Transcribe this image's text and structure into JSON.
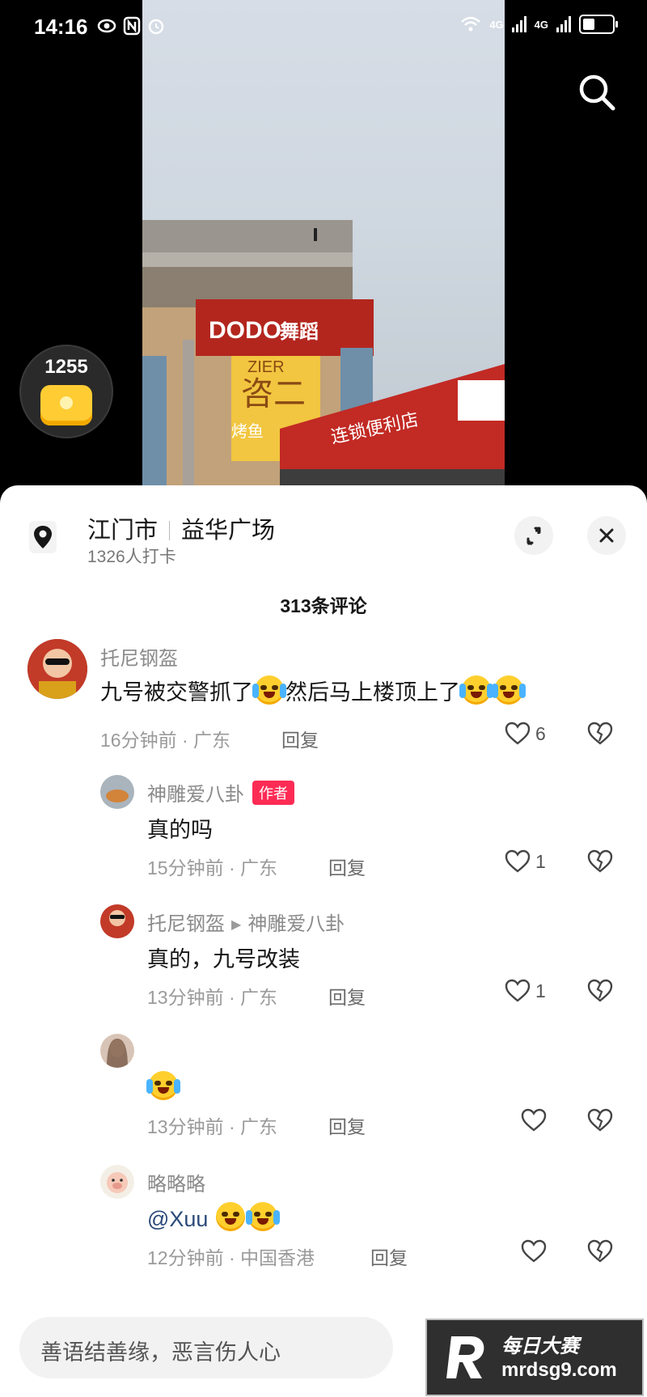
{
  "status_bar": {
    "time": "14:16",
    "signal_1": "4G",
    "signal_2": "4G"
  },
  "coin_badge": {
    "count": "1255"
  },
  "location": {
    "city": "江门市",
    "place": "益华广场",
    "checkins": "1326人打卡"
  },
  "comments_count": "313条评论",
  "author_tag": "作者",
  "reply_label": "回复",
  "comments": [
    {
      "user": "托尼钢盔",
      "text_parts": [
        "九号被交警抓了",
        "然后马上楼顶上了"
      ],
      "time": "16分钟前",
      "region": "广东",
      "likes": "6"
    },
    {
      "user": "神雕爱八卦",
      "text": "真的吗",
      "time": "15分钟前",
      "region": "广东",
      "likes": "1"
    },
    {
      "user": "托尼钢盔",
      "reply_to": "神雕爱八卦",
      "text": "真的，九号改装",
      "time": "13分钟前",
      "region": "广东",
      "likes": "1"
    },
    {
      "user": "",
      "text": "",
      "time": "13分钟前",
      "region": "广东",
      "likes": ""
    },
    {
      "user": "略略略",
      "text": "@Xuu",
      "time": "12分钟前",
      "region": "中国香港",
      "likes": ""
    }
  ],
  "input": {
    "placeholder": "善语结善缘，恶言伤人心"
  },
  "watermark": {
    "line1": "每日大赛",
    "line2": "mrdsg9.com"
  },
  "video_signs": {
    "sign1": "DODO",
    "sign2": "舞蹈",
    "sign3": "ZIER",
    "sign4": "咨二",
    "sign5": "烤鱼",
    "sign6": "连锁便利店"
  },
  "colors": {
    "accent": "#fe2c55",
    "sheet_bg": "#ffffff",
    "text_primary": "#161616",
    "text_secondary": "#8a8a8a"
  },
  "icons": [
    "search-icon",
    "location-pin-icon",
    "expand-icon",
    "close-icon",
    "heart-icon",
    "broken-heart-icon",
    "coin-icon"
  ]
}
